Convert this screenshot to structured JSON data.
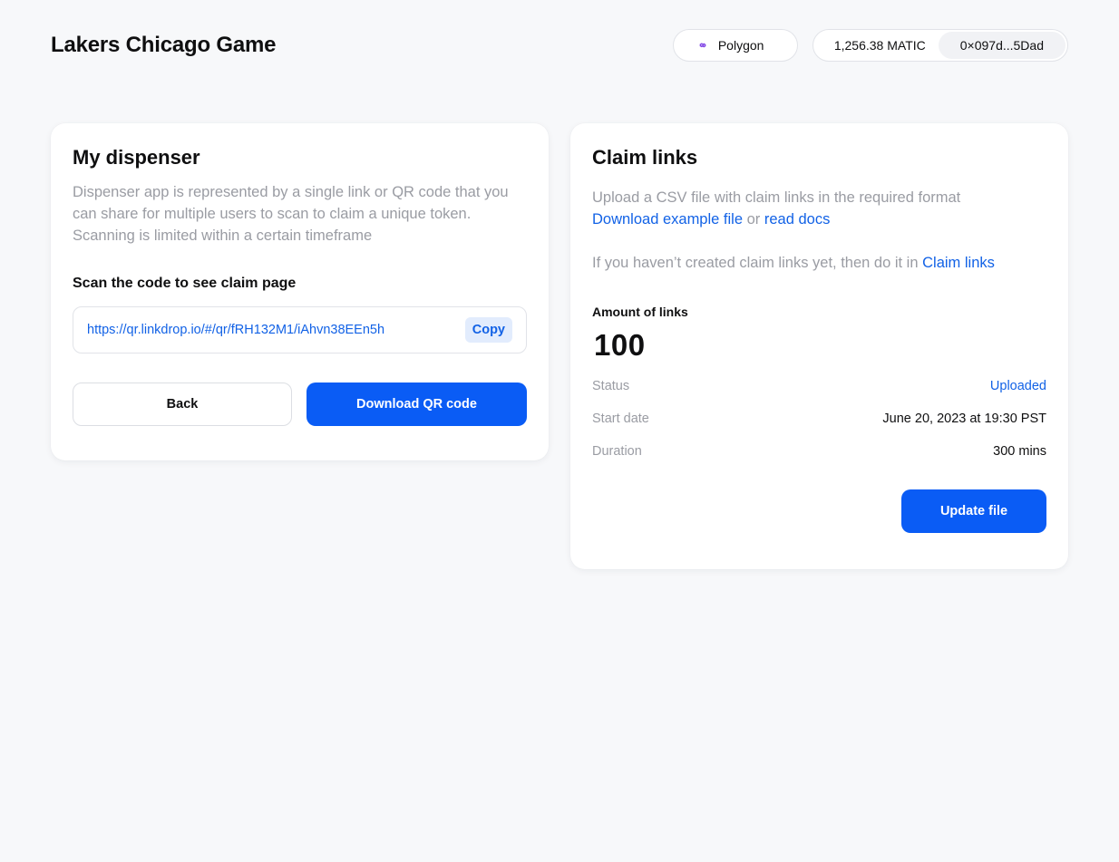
{
  "header": {
    "title": "Lakers Chicago Game",
    "network": {
      "label": "Polygon",
      "icon": "polygon-icon",
      "icon_color": "#8247e5"
    },
    "account": {
      "balance": "1,256.38 MATIC",
      "address": "0×097d...5Dad"
    }
  },
  "dispenser": {
    "title": "My dispenser",
    "description": "Dispenser app is represented by a single link or QR code that you can share for multiple users to scan to claim a unique token. Scanning is limited within a certain timeframe",
    "scan_label": "Scan the code to see claim page",
    "link": "https://qr.linkdrop.io/#/qr/fRH132M1/iAhvn38EEn5h",
    "copy_label": "Copy",
    "back_label": "Back",
    "download_label": "Download QR code"
  },
  "claim_links": {
    "title": "Claim links",
    "upload_text": "Upload a CSV file with claim links in the required format",
    "download_example_label": "Download example file",
    "or_text": "or",
    "read_docs_label": "read docs",
    "hint_text": "If you haven’t created claim links yet, then do it in",
    "hint_link_label": "Claim links",
    "amount_label": "Amount of links",
    "amount_value": "100",
    "rows": [
      {
        "label": "Status",
        "value": "Uploaded"
      },
      {
        "label": "Start date",
        "value": "June 20, 2023 at 19:30 PST"
      },
      {
        "label": "Duration",
        "value": "300 mins"
      }
    ],
    "update_label": "Update file"
  },
  "colors": {
    "accent": "#0a5cf5",
    "link": "#1262e6",
    "muted_text": "#9a9ca3",
    "background": "#f7f8fa"
  }
}
